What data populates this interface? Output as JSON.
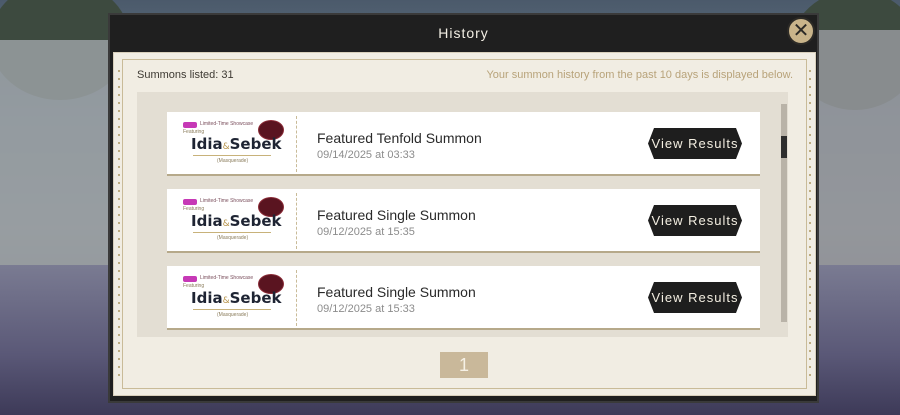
{
  "modal": {
    "title": "History",
    "close_icon": "✕"
  },
  "summary": {
    "count_label": "Summons listed: 31",
    "notice": "Your summon history from the past 10 days is displayed below."
  },
  "rows": [
    {
      "banner": {
        "tag": "Limited-Time Showcase",
        "featuring": "Featuring",
        "name_a": "Idia",
        "amp": "&",
        "name_b": "Sebek",
        "subtitle": "(Masquerade)"
      },
      "title": "Featured Tenfold Summon",
      "date": "09/14/2025 at 03:33",
      "button": "View Results"
    },
    {
      "banner": {
        "tag": "Limited-Time Showcase",
        "featuring": "Featuring",
        "name_a": "Idia",
        "amp": "&",
        "name_b": "Sebek",
        "subtitle": "(Masquerade)"
      },
      "title": "Featured Single Summon",
      "date": "09/12/2025 at 15:35",
      "button": "View Results"
    },
    {
      "banner": {
        "tag": "Limited-Time Showcase",
        "featuring": "Featuring",
        "name_a": "Idia",
        "amp": "&",
        "name_b": "Sebek",
        "subtitle": "(Masquerade)"
      },
      "title": "Featured Single Summon",
      "date": "09/12/2025 at 15:33",
      "button": "View Results"
    }
  ],
  "pagination": {
    "current_page": "1"
  },
  "colors": {
    "panel": "#f1ede3",
    "accent_gold": "#c9b48a",
    "button_dark": "#1e1e1e",
    "tag_magenta": "#c639b6"
  }
}
